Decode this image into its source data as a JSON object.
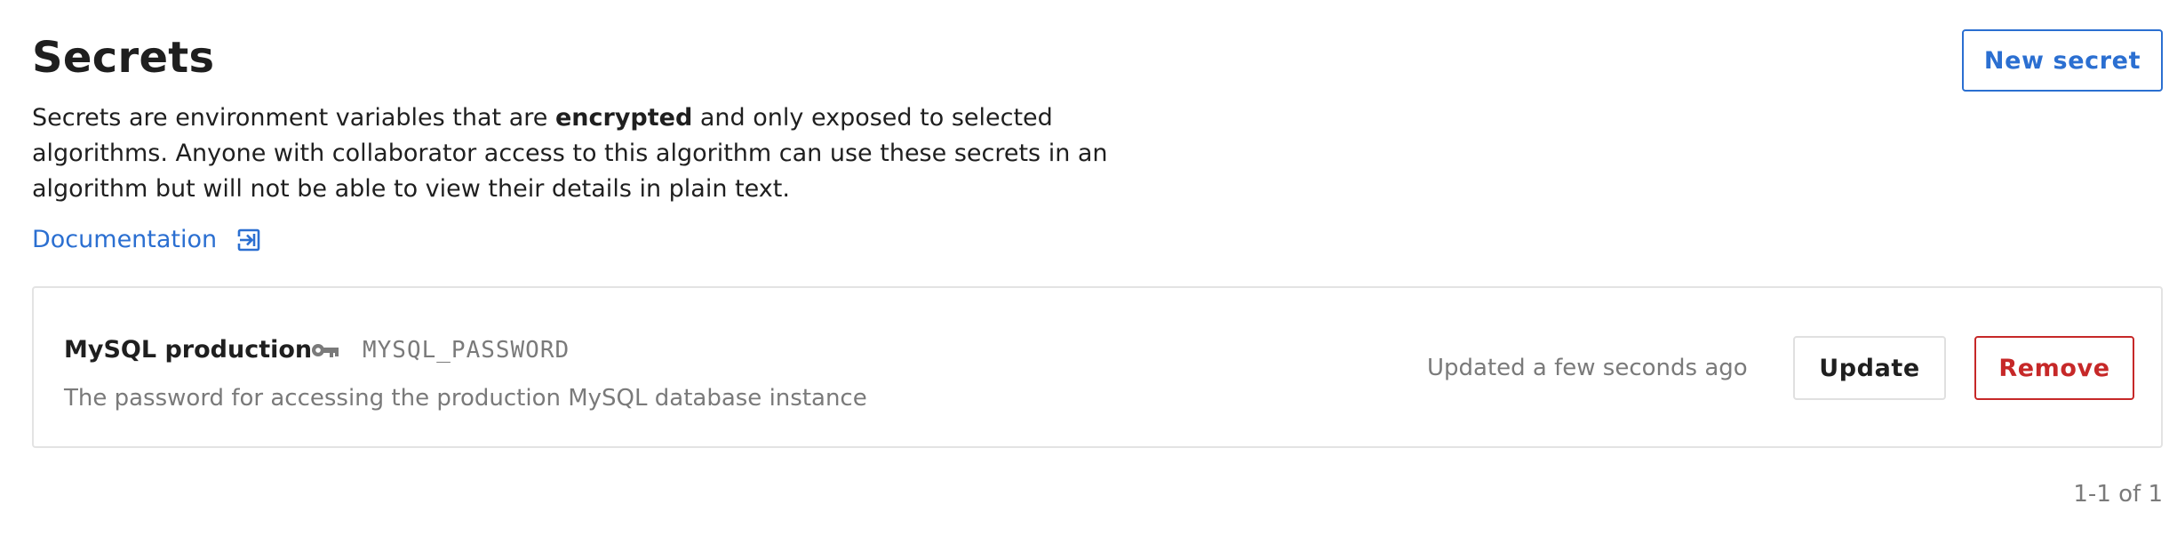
{
  "header": {
    "title": "Secrets",
    "new_secret_label": "New secret"
  },
  "description": {
    "line1_before": "Secrets are environment variables that are ",
    "line1_bold": "encrypted",
    "line1_after": " and only exposed to selected",
    "line2": "algorithms. Anyone with collaborator access to this algorithm can use these secrets in an",
    "line3": "algorithm but will not be able to view their details in plain text."
  },
  "documentation": {
    "label": "Documentation",
    "icon": "external-link-icon"
  },
  "secrets": [
    {
      "name": "MySQL production",
      "icon": "key-icon",
      "env_var": "MYSQL_PASSWORD",
      "description": "The password for accessing the production MySQL database instance",
      "updated": "Updated a few seconds ago",
      "update_label": "Update",
      "remove_label": "Remove"
    }
  ],
  "pagination": {
    "text": "1-1 of 1"
  },
  "colors": {
    "accent": "#2b6fd1",
    "danger": "#c62828",
    "muted_text": "#7a7a7a",
    "border": "#e3e3e3"
  }
}
